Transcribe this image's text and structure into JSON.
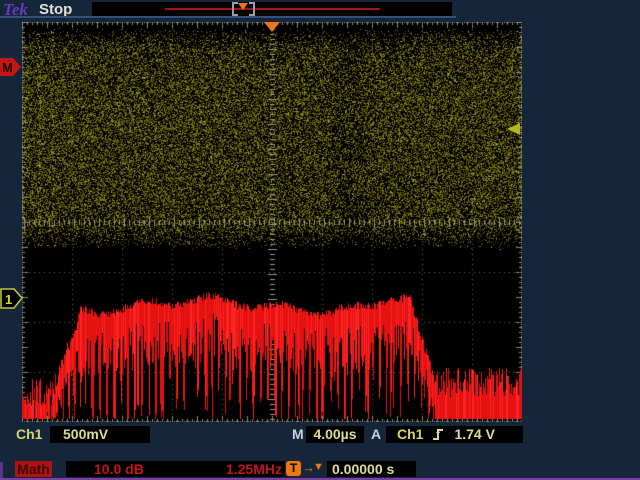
{
  "header": {
    "logo": "Tek",
    "status": "Stop"
  },
  "markers": {
    "math_label": "M",
    "ch1_label": "1",
    "trigger_glyph": "▼"
  },
  "status_row": {
    "ch1_label": "Ch1",
    "ch1_scale": "500mV",
    "time_label": "M",
    "time_scale": "4.00µs",
    "trig_mode": "A",
    "trig_source": "Ch1",
    "trig_level": "1.74 V"
  },
  "math_row": {
    "label": "Math",
    "v_scale": "10.0 dB",
    "h_scale": "1.25MHz",
    "t_letter": "T",
    "arrow": "→",
    "glyph": "▼",
    "h_position": "0.00000 s"
  },
  "waveforms": {
    "ch1": {
      "marker": "1",
      "type": "time-domain noise band",
      "volts_per_div": "500mV",
      "color": "#8a8a18"
    },
    "math": {
      "marker": "M",
      "type": "FFT spectrum",
      "db_per_div": "10.0 dB",
      "freq_per_div": "1.25MHz",
      "color": "#e41212"
    }
  },
  "display": {
    "divisions_h": 10,
    "divisions_v": 8
  },
  "colors": {
    "background": "#15263a",
    "graticule_bg": "#000000",
    "accent_orange": "#ee7711",
    "channel_yellow": "#8a8a18",
    "math_red": "#e41212",
    "readout_cream": "#dcdc96",
    "logo_purple": "#6a38c0",
    "selected_red_bg": "#b01212"
  }
}
